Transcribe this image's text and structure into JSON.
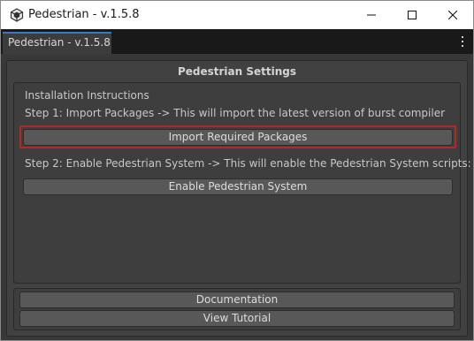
{
  "window": {
    "title": "Pedestrian - v.1.5.8",
    "icon": "unity-icon"
  },
  "tabstrip": {
    "tab_label": "Pedestrian - v.1.5.8",
    "menu_icon": "kebab-menu-icon"
  },
  "panel": {
    "title": "Pedestrian Settings",
    "install_header": "Installation Instructions",
    "step1": "Step 1: Import Packages -> This will import the latest version of burst compiler",
    "import_button": "Import Required Packages",
    "step2": "Step 2: Enable Pedestrian System -> This will enable the Pedestrian System scripts:",
    "enable_button": "Enable Pedestrian System"
  },
  "footer": {
    "documentation_button": "Documentation",
    "tutorial_button": "View Tutorial"
  },
  "colors": {
    "highlight": "#b02a2a",
    "tab_accent": "#3a79bb"
  }
}
